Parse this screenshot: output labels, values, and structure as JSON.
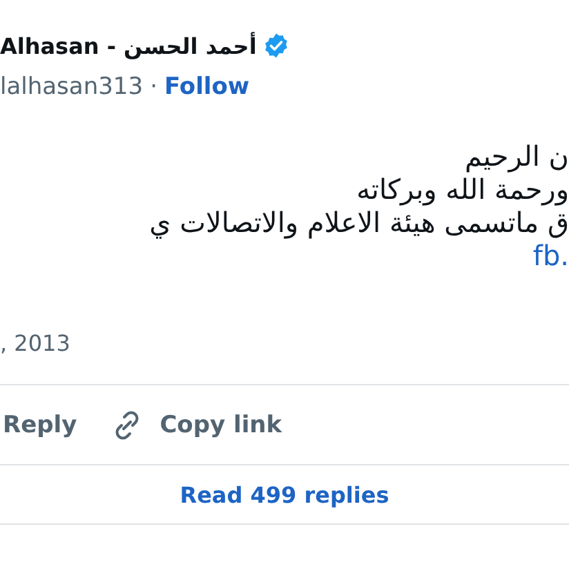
{
  "author": {
    "name": "Alhasan - أحمد الحسن",
    "verified": true,
    "handle": "lalhasan313",
    "separator": "·",
    "follow": "Follow"
  },
  "tweet": {
    "lines": [
      "ن الرحيم",
      "ورحمة الله وبركاته",
      "ق ماتسمى هيئة الاعلام والاتصالات ي"
    ],
    "link": "fb.",
    "date": ", 2013"
  },
  "actions": {
    "reply": "Reply",
    "copy_link": "Copy link"
  },
  "replies_link": "Read 499 replies"
}
